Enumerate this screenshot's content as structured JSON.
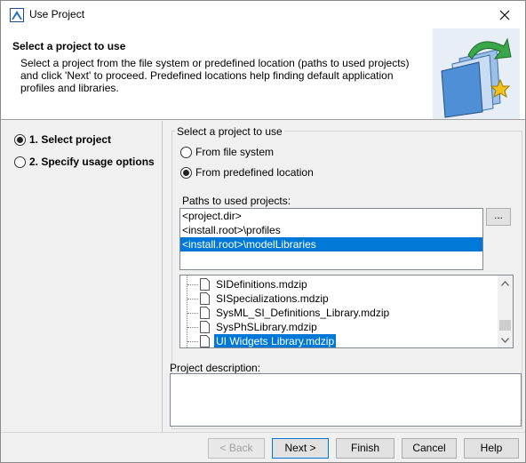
{
  "window": {
    "title": "Use Project",
    "close_glyph": "✕"
  },
  "header": {
    "title": "Select a project to use",
    "description": "Select a project from the file system or predefined location (paths to used projects) and click 'Next' to proceed. Predefined locations help finding default application profiles and libraries."
  },
  "steps": [
    {
      "label": "1. Select project",
      "selected": true
    },
    {
      "label": "2. Specify usage options",
      "selected": false
    }
  ],
  "source_group": {
    "label": "Select a project to use",
    "options": [
      {
        "label": "From file system",
        "selected": false
      },
      {
        "label": "From predefined location",
        "selected": true
      }
    ]
  },
  "paths": {
    "label": "Paths to used projects:",
    "items": [
      {
        "label": "<project.dir>",
        "selected": false
      },
      {
        "label": "<install.root>\\profiles",
        "selected": false
      },
      {
        "label": "<install.root>\\modelLibraries",
        "selected": true
      }
    ],
    "browse_label": "..."
  },
  "files": {
    "items": [
      {
        "label": "SIDefinitions.mdzip",
        "selected": false
      },
      {
        "label": "SISpecializations.mdzip",
        "selected": false
      },
      {
        "label": "SysML_SI_Definitions_Library.mdzip",
        "selected": false
      },
      {
        "label": "SysPhSLibrary.mdzip",
        "selected": false
      },
      {
        "label": "UI Widgets Library.mdzip",
        "selected": true
      }
    ]
  },
  "project_description": {
    "label": "Project description:",
    "value": ""
  },
  "buttons": {
    "back": "< Back",
    "next": "Next >",
    "finish": "Finish",
    "cancel": "Cancel",
    "help": "Help"
  },
  "colors": {
    "selection": "#0078d7",
    "dialog_bg": "#f0f0f0"
  }
}
